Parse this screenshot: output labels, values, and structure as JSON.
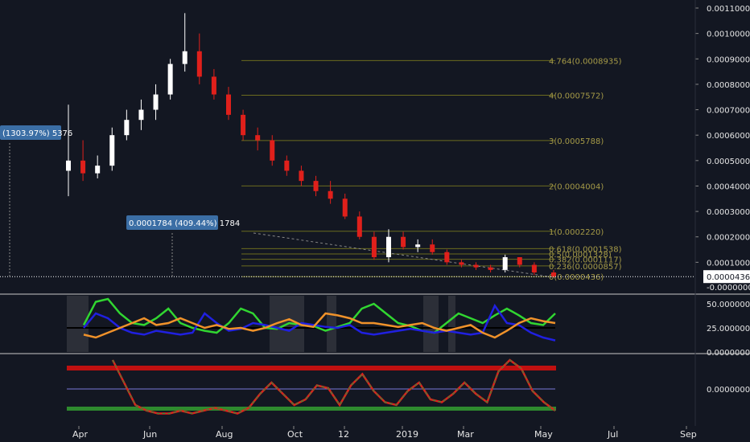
{
  "colors": {
    "background": "#131722",
    "up": "#ffffff",
    "down": "#e0201b",
    "fib": "#6b6b1f",
    "fib_text": "#a59a47",
    "axis_text": "#e6e6e6",
    "grid_pane_line": "#c8c8c8",
    "badge": "#3b6ea5",
    "green": "#31d631",
    "pink": "#ff3d8b",
    "blue": "#2020e0",
    "orange": "#f0922a",
    "stoch_red": "#e0201b",
    "stoch_green": "#1e9a3a",
    "band_red": "#c01010",
    "band_green": "#2e8a2e",
    "mid_line": "#7a7ad8"
  },
  "chart_data": [
    {
      "type": "candlestick",
      "xlabels": [
        "Apr",
        "Jun",
        "Aug",
        "Oct",
        "12",
        "2019",
        "Mar",
        "May",
        "Jul",
        "Sep"
      ],
      "ytick_labels": [
        "0.0011000",
        "0.0010000",
        "0.0009000",
        "0.0008000",
        "0.0007000",
        "0.0006000",
        "0.0005000",
        "0.0004000",
        "0.0003000",
        "0.0002000",
        "0.0001000",
        "0.0000436",
        "-0.0000000"
      ],
      "ylim": [
        -0.0,
        0.0011
      ],
      "current_price": "0.0000436",
      "fib_levels": [
        {
          "ratio": 4.764,
          "label": "4.764(0.0008935)",
          "value": 0.0008935
        },
        {
          "ratio": 4,
          "label": "4(0.0007572)",
          "value": 0.0007572
        },
        {
          "ratio": 3,
          "label": "3(0.0005788)",
          "value": 0.0005788
        },
        {
          "ratio": 2,
          "label": "2(0.0004004)",
          "value": 0.0004004
        },
        {
          "ratio": 1,
          "label": "1(0.0002220)",
          "value": 0.000222
        },
        {
          "ratio": 0.618,
          "label": "0.618(0.0001538)",
          "value": 0.0001538
        },
        {
          "ratio": 0.5,
          "label": "0.5(0.0001328)",
          "value": 0.0001328
        },
        {
          "ratio": 0.382,
          "label": "0.382(0.0001117)",
          "value": 0.0001117
        },
        {
          "ratio": 0.236,
          "label": "0.236(0.0000857)",
          "value": 8.57e-05
        },
        {
          "ratio": 0,
          "label": "0(0.0000436)",
          "value": 4.36e-05
        }
      ],
      "annotations": [
        {
          "text": "(1303.97%) 5376",
          "value": 0.00058
        },
        {
          "text": "0.0001784 (409.44%) 1784",
          "value": 0.00022
        }
      ],
      "candles": [
        {
          "t": 0.0,
          "o": 0.00046,
          "h": 0.00072,
          "l": 0.00036,
          "c": 0.0005
        },
        {
          "t": 0.03,
          "o": 0.0005,
          "h": 0.00058,
          "l": 0.00042,
          "c": 0.00045
        },
        {
          "t": 0.06,
          "o": 0.00045,
          "h": 0.00052,
          "l": 0.00043,
          "c": 0.00048
        },
        {
          "t": 0.09,
          "o": 0.00048,
          "h": 0.00063,
          "l": 0.00046,
          "c": 0.0006
        },
        {
          "t": 0.12,
          "o": 0.0006,
          "h": 0.0007,
          "l": 0.00058,
          "c": 0.00066
        },
        {
          "t": 0.15,
          "o": 0.00066,
          "h": 0.00074,
          "l": 0.00062,
          "c": 0.0007
        },
        {
          "t": 0.18,
          "o": 0.0007,
          "h": 0.0008,
          "l": 0.00066,
          "c": 0.00076
        },
        {
          "t": 0.21,
          "o": 0.00076,
          "h": 0.0009,
          "l": 0.00074,
          "c": 0.00088
        },
        {
          "t": 0.24,
          "o": 0.00088,
          "h": 0.00108,
          "l": 0.00085,
          "c": 0.00093
        },
        {
          "t": 0.27,
          "o": 0.00093,
          "h": 0.001,
          "l": 0.0008,
          "c": 0.00083
        },
        {
          "t": 0.3,
          "o": 0.00083,
          "h": 0.00086,
          "l": 0.00074,
          "c": 0.00076
        },
        {
          "t": 0.33,
          "o": 0.00076,
          "h": 0.00079,
          "l": 0.00066,
          "c": 0.00068
        },
        {
          "t": 0.36,
          "o": 0.00068,
          "h": 0.0007,
          "l": 0.00058,
          "c": 0.0006
        },
        {
          "t": 0.39,
          "o": 0.0006,
          "h": 0.00063,
          "l": 0.00054,
          "c": 0.00058
        },
        {
          "t": 0.42,
          "o": 0.00058,
          "h": 0.0006,
          "l": 0.00048,
          "c": 0.0005
        },
        {
          "t": 0.45,
          "o": 0.0005,
          "h": 0.00052,
          "l": 0.00044,
          "c": 0.00046
        },
        {
          "t": 0.48,
          "o": 0.00046,
          "h": 0.00048,
          "l": 0.0004,
          "c": 0.00042
        },
        {
          "t": 0.51,
          "o": 0.00042,
          "h": 0.00044,
          "l": 0.00036,
          "c": 0.00038
        },
        {
          "t": 0.54,
          "o": 0.00038,
          "h": 0.00042,
          "l": 0.00033,
          "c": 0.00035
        },
        {
          "t": 0.57,
          "o": 0.00035,
          "h": 0.00037,
          "l": 0.00027,
          "c": 0.00028
        },
        {
          "t": 0.6,
          "o": 0.00028,
          "h": 0.0003,
          "l": 0.00019,
          "c": 0.0002
        },
        {
          "t": 0.63,
          "o": 0.0002,
          "h": 0.00022,
          "l": 0.00011,
          "c": 0.00012
        },
        {
          "t": 0.66,
          "o": 0.00012,
          "h": 0.00023,
          "l": 0.0001,
          "c": 0.0002
        },
        {
          "t": 0.69,
          "o": 0.0002,
          "h": 0.00022,
          "l": 0.00015,
          "c": 0.00016
        },
        {
          "t": 0.72,
          "o": 0.00016,
          "h": 0.00019,
          "l": 0.00014,
          "c": 0.00017
        },
        {
          "t": 0.75,
          "o": 0.00017,
          "h": 0.00019,
          "l": 0.00013,
          "c": 0.00014
        },
        {
          "t": 0.78,
          "o": 0.00014,
          "h": 0.00015,
          "l": 9e-05,
          "c": 0.0001
        },
        {
          "t": 0.81,
          "o": 0.0001,
          "h": 0.00011,
          "l": 8e-05,
          "c": 9e-05
        },
        {
          "t": 0.84,
          "o": 9e-05,
          "h": 0.0001,
          "l": 7e-05,
          "c": 8e-05
        },
        {
          "t": 0.87,
          "o": 8e-05,
          "h": 9e-05,
          "l": 6e-05,
          "c": 7e-05
        },
        {
          "t": 0.9,
          "o": 7e-05,
          "h": 0.00013,
          "l": 6e-05,
          "c": 0.00012
        },
        {
          "t": 0.93,
          "o": 0.00012,
          "h": 0.00012,
          "l": 8e-05,
          "c": 9e-05
        },
        {
          "t": 0.96,
          "o": 9e-05,
          "h": 0.0001,
          "l": 5e-05,
          "c": 6e-05
        },
        {
          "t": 1.0,
          "o": 6e-05,
          "h": 7e-05,
          "l": 4e-05,
          "c": 4.36e-05
        }
      ]
    },
    {
      "type": "line",
      "ytick_labels": [
        "50.0000000",
        "25.0000000",
        "0.0000000"
      ],
      "ylim": [
        0,
        50
      ],
      "series": [
        {
          "color": "green/pink",
          "values": [
            28,
            52,
            55,
            40,
            30,
            28,
            35,
            45,
            30,
            25,
            22,
            20,
            30,
            45,
            40,
            25,
            24,
            30,
            28,
            27,
            22,
            26,
            30,
            45,
            50,
            40,
            30,
            27,
            22,
            20,
            30,
            40,
            35,
            30,
            38,
            45,
            38,
            30,
            28,
            40
          ]
        },
        {
          "color": "blue",
          "values": [
            25,
            40,
            35,
            25,
            20,
            18,
            22,
            20,
            18,
            20,
            40,
            30,
            22,
            24,
            30,
            28,
            25,
            22,
            30,
            28,
            26,
            25,
            28,
            20,
            18,
            20,
            22,
            24,
            22,
            20,
            22,
            20,
            18,
            20,
            48,
            30,
            28,
            20,
            15,
            12
          ]
        },
        {
          "color": "orange",
          "values": [
            18,
            15,
            20,
            25,
            30,
            35,
            28,
            30,
            35,
            30,
            25,
            28,
            24,
            25,
            22,
            25,
            30,
            34,
            28,
            26,
            40,
            38,
            35,
            30,
            30,
            28,
            26,
            28,
            30,
            25,
            22,
            25,
            28,
            20,
            15,
            22,
            30,
            35,
            32,
            30
          ]
        }
      ]
    },
    {
      "type": "line",
      "ytick_labels": [
        "0.0000000"
      ],
      "ylim": [
        0,
        100
      ],
      "series": [
        {
          "color": "red/green",
          "values": [
            100,
            60,
            20,
            10,
            5,
            5,
            10,
            5,
            10,
            15,
            10,
            5,
            15,
            40,
            60,
            40,
            20,
            30,
            55,
            50,
            20,
            55,
            75,
            45,
            25,
            20,
            45,
            60,
            30,
            25,
            40,
            60,
            40,
            25,
            80,
            100,
            85,
            45,
            25,
            10
          ]
        }
      ]
    }
  ],
  "price_box": "0.0000436"
}
